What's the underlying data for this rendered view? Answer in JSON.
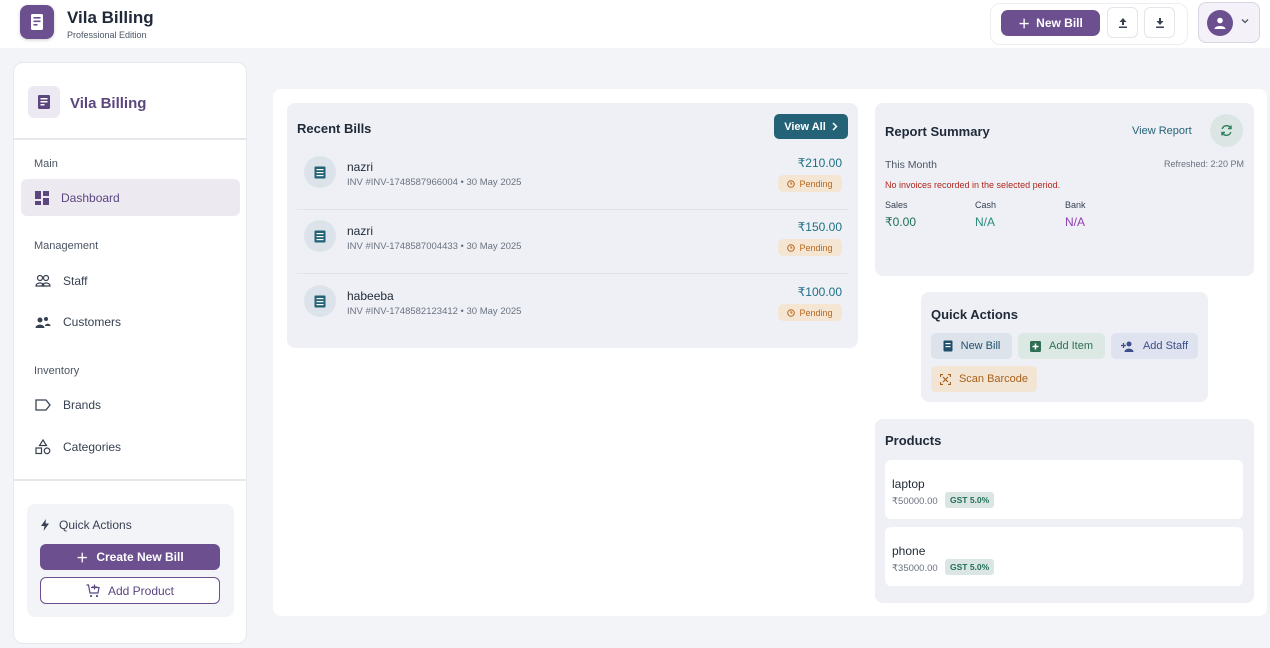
{
  "header": {
    "title": "Vila Billing",
    "subtitle": "Professional Edition",
    "new_bill_label": "New Bill",
    "logo_icon": "receipt-icon",
    "upload_icon": "upload-icon",
    "download_icon": "download-icon",
    "profile_icon": "user-icon"
  },
  "sidebar": {
    "brand": "Vila Billing",
    "sections": {
      "main": "Main",
      "management": "Management",
      "inventory": "Inventory"
    },
    "items": [
      {
        "label": "Dashboard",
        "icon": "dashboard-icon",
        "active": true
      },
      {
        "label": "Staff",
        "icon": "users-icon"
      },
      {
        "label": "Customers",
        "icon": "customers-icon"
      },
      {
        "label": "Brands",
        "icon": "tag-icon"
      },
      {
        "label": "Categories",
        "icon": "shapes-icon"
      }
    ],
    "quick_actions": {
      "title": "Quick Actions",
      "create_label": "Create New Bill",
      "add_product_label": "Add Product"
    }
  },
  "recent_bills": {
    "title": "Recent Bills",
    "view_all_label": "View All",
    "bills": [
      {
        "name": "nazri",
        "meta": "INV #INV-1748587966004 • 30 May 2025",
        "amount": "₹210.00",
        "status": "Pending"
      },
      {
        "name": "nazri",
        "meta": "INV #INV-1748587004433 • 30 May 2025",
        "amount": "₹150.00",
        "status": "Pending"
      },
      {
        "name": "habeeba",
        "meta": "INV #INV-1748582123412 • 30 May 2025",
        "amount": "₹100.00",
        "status": "Pending"
      }
    ]
  },
  "report": {
    "title": "Report Summary",
    "view_report_label": "View Report",
    "period": "This Month",
    "refreshed": "Refreshed: 2:20 PM",
    "notice": "No invoices recorded in the selected period.",
    "stats": [
      {
        "label": "Sales",
        "value": "₹0.00",
        "color": "#1f6f56"
      },
      {
        "label": "Cash",
        "value": "N/A",
        "color": "#2a8c7b"
      },
      {
        "label": "Bank",
        "value": "N/A",
        "color": "#8e3fb0"
      }
    ]
  },
  "quick_actions": {
    "title": "Quick Actions",
    "new_bill": "New Bill",
    "add_item": "Add Item",
    "add_staff": "Add Staff",
    "scan_barcode": "Scan Barcode"
  },
  "products": {
    "title": "Products",
    "items": [
      {
        "name": "laptop",
        "price": "₹50000.00",
        "gst": "GST 5.0%"
      },
      {
        "name": "phone",
        "price": "₹35000.00",
        "gst": "GST 5.0%"
      }
    ]
  },
  "colors": {
    "brand": "#6b4f8f",
    "teal": "#246277",
    "pending": "#b7681f"
  }
}
